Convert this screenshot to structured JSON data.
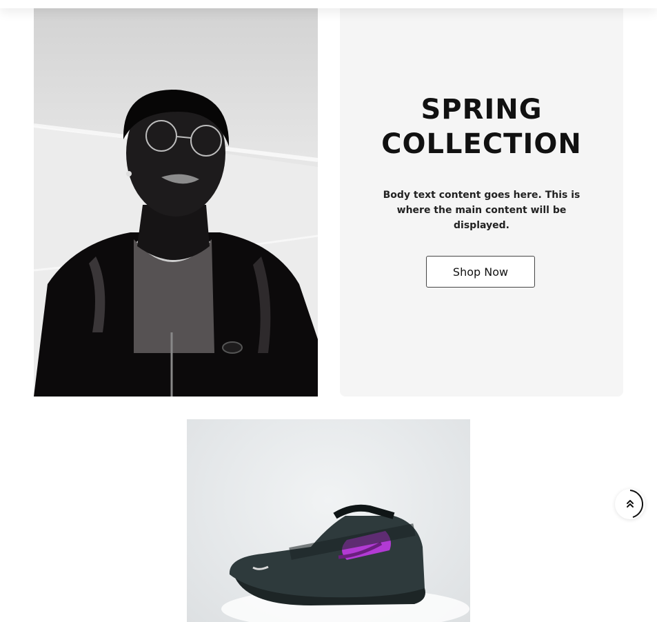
{
  "promo": {
    "title": "SPRING\nCOLLECTION",
    "body": "Body text content goes here. This is where the main content will be displayed.",
    "button_label": "Shop Now"
  },
  "images": {
    "hero": "portrait-photo",
    "product": "sneaker-photo"
  },
  "scroll_top": {
    "icon": "double-chevron-up-icon"
  },
  "colors": {
    "card_bg": "#f5f5f5",
    "text": "#111111",
    "button_border": "#444444",
    "sneaker_accent": "#b23ad4"
  }
}
